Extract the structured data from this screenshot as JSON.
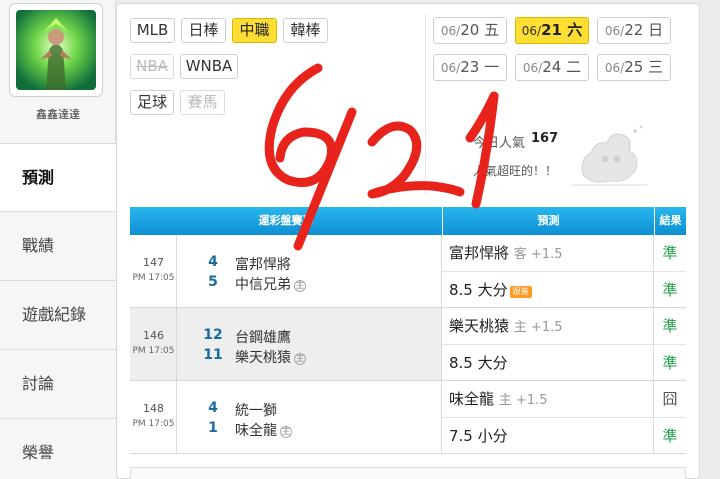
{
  "profile": {
    "username": "鑫鑫達達"
  },
  "sidebar": {
    "items": [
      {
        "label": "預測",
        "active": true
      },
      {
        "label": "戰績"
      },
      {
        "label": "遊戲紀錄"
      },
      {
        "label": "討論"
      },
      {
        "label": "榮譽"
      }
    ]
  },
  "leagues": {
    "mlb": "MLB",
    "npb": "日棒",
    "cpbl": "中職",
    "kbo": "韓棒",
    "nba": "NBA",
    "wnba": "WNBA",
    "soccer": "足球",
    "horse": "賽馬"
  },
  "dates": [
    {
      "md": "06/",
      "day": "20",
      "wd": "五"
    },
    {
      "md": "06/",
      "day": "21",
      "wd": "六",
      "active": true
    },
    {
      "md": "06/",
      "day": "22",
      "wd": "日"
    },
    {
      "md": "06/",
      "day": "23",
      "wd": "一"
    },
    {
      "md": "06/",
      "day": "24",
      "wd": "二"
    },
    {
      "md": "06/",
      "day": "25",
      "wd": "三"
    }
  ],
  "popularity": {
    "label": "今日人氣",
    "value": "167",
    "desc": "人氣超旺的！！"
  },
  "table": {
    "headers": {
      "games": "運彩盤賽事",
      "prediction": "預測",
      "result": "結果"
    },
    "rows": [
      {
        "num": "147",
        "time": "PM 17:05",
        "away": {
          "score": "4",
          "name": "富邦悍將"
        },
        "home": {
          "score": "5",
          "name": "中信兄弟",
          "tag": "主"
        },
        "pred1": {
          "text": "富邦悍將",
          "sub": "客 +1.5"
        },
        "res1": "準",
        "pred2": {
          "text": "8.5 大分",
          "badge": "跟進"
        },
        "res2": "準"
      },
      {
        "num": "146",
        "time": "PM 17:05",
        "away": {
          "score": "12",
          "name": "台鋼雄鷹"
        },
        "home": {
          "score": "11",
          "name": "樂天桃猿",
          "tag": "主"
        },
        "pred1": {
          "text": "樂天桃猿",
          "sub": "主 +1.5"
        },
        "res1": "準",
        "pred2": {
          "text": "8.5 大分"
        },
        "res2": "準"
      },
      {
        "num": "148",
        "time": "PM 17:05",
        "away": {
          "score": "4",
          "name": "統一獅"
        },
        "home": {
          "score": "1",
          "name": "味全龍",
          "tag": "主"
        },
        "pred1": {
          "text": "味全龍",
          "sub": "主 +1.5"
        },
        "res1": "囧",
        "pred2": {
          "text": "7.5 小分"
        },
        "res2": "準"
      }
    ]
  },
  "annotation": {
    "text": "6/21",
    "color": "#e8231b"
  },
  "colors": {
    "accent": "#ffde33",
    "header": "#1aa3e3",
    "hit": "#1ea045"
  }
}
